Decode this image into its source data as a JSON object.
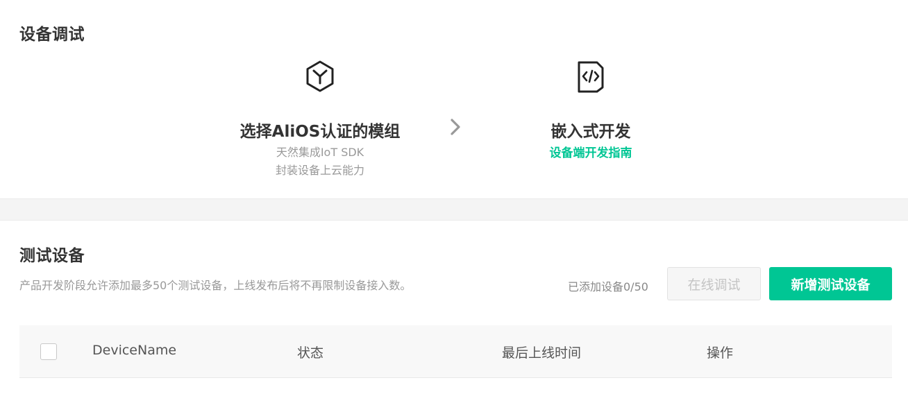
{
  "device_debug": {
    "title": "设备调试",
    "steps": [
      {
        "icon": "module-cube-icon",
        "title": "选择AliOS认证的模组",
        "desc_line1": "天然集成IoT SDK",
        "desc_line2": "封装设备上云能力"
      },
      {
        "icon": "code-file-icon",
        "title": "嵌入式开发",
        "link": "设备端开发指南"
      }
    ],
    "arrow_icon": "chevron-right-icon"
  },
  "test_devices": {
    "title": "测试设备",
    "description": "产品开发阶段允许添加最多50个测试设备，上线发布后将不再限制设备接入数。",
    "count_label": "已添加设备0/50",
    "online_debug_button": "在线调试",
    "add_device_button": "新增测试设备",
    "table": {
      "columns": [
        "DeviceName",
        "状态",
        "最后上线时间",
        "操作"
      ]
    }
  },
  "colors": {
    "accent": "#00c694",
    "text_primary": "#333333",
    "text_muted": "#999999",
    "band": "#f4f4f4"
  }
}
